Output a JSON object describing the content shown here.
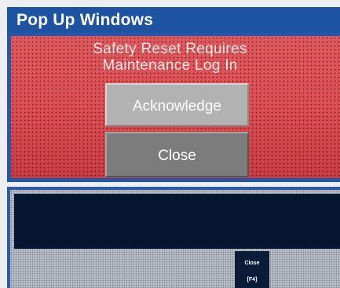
{
  "header": {
    "title": "Pop Up Windows"
  },
  "popup": {
    "message_line1": "Safety Reset Requires",
    "message_line2": "Maintenance Log In",
    "acknowledge_label": "Acknowledge",
    "close_label": "Close"
  },
  "secondary_panel": {
    "close_label": "Close",
    "close_key": "[F4]"
  },
  "colors": {
    "header_bg": "#1d53a1",
    "alarm_red": "#dd4f55",
    "display_navy": "#061630"
  }
}
